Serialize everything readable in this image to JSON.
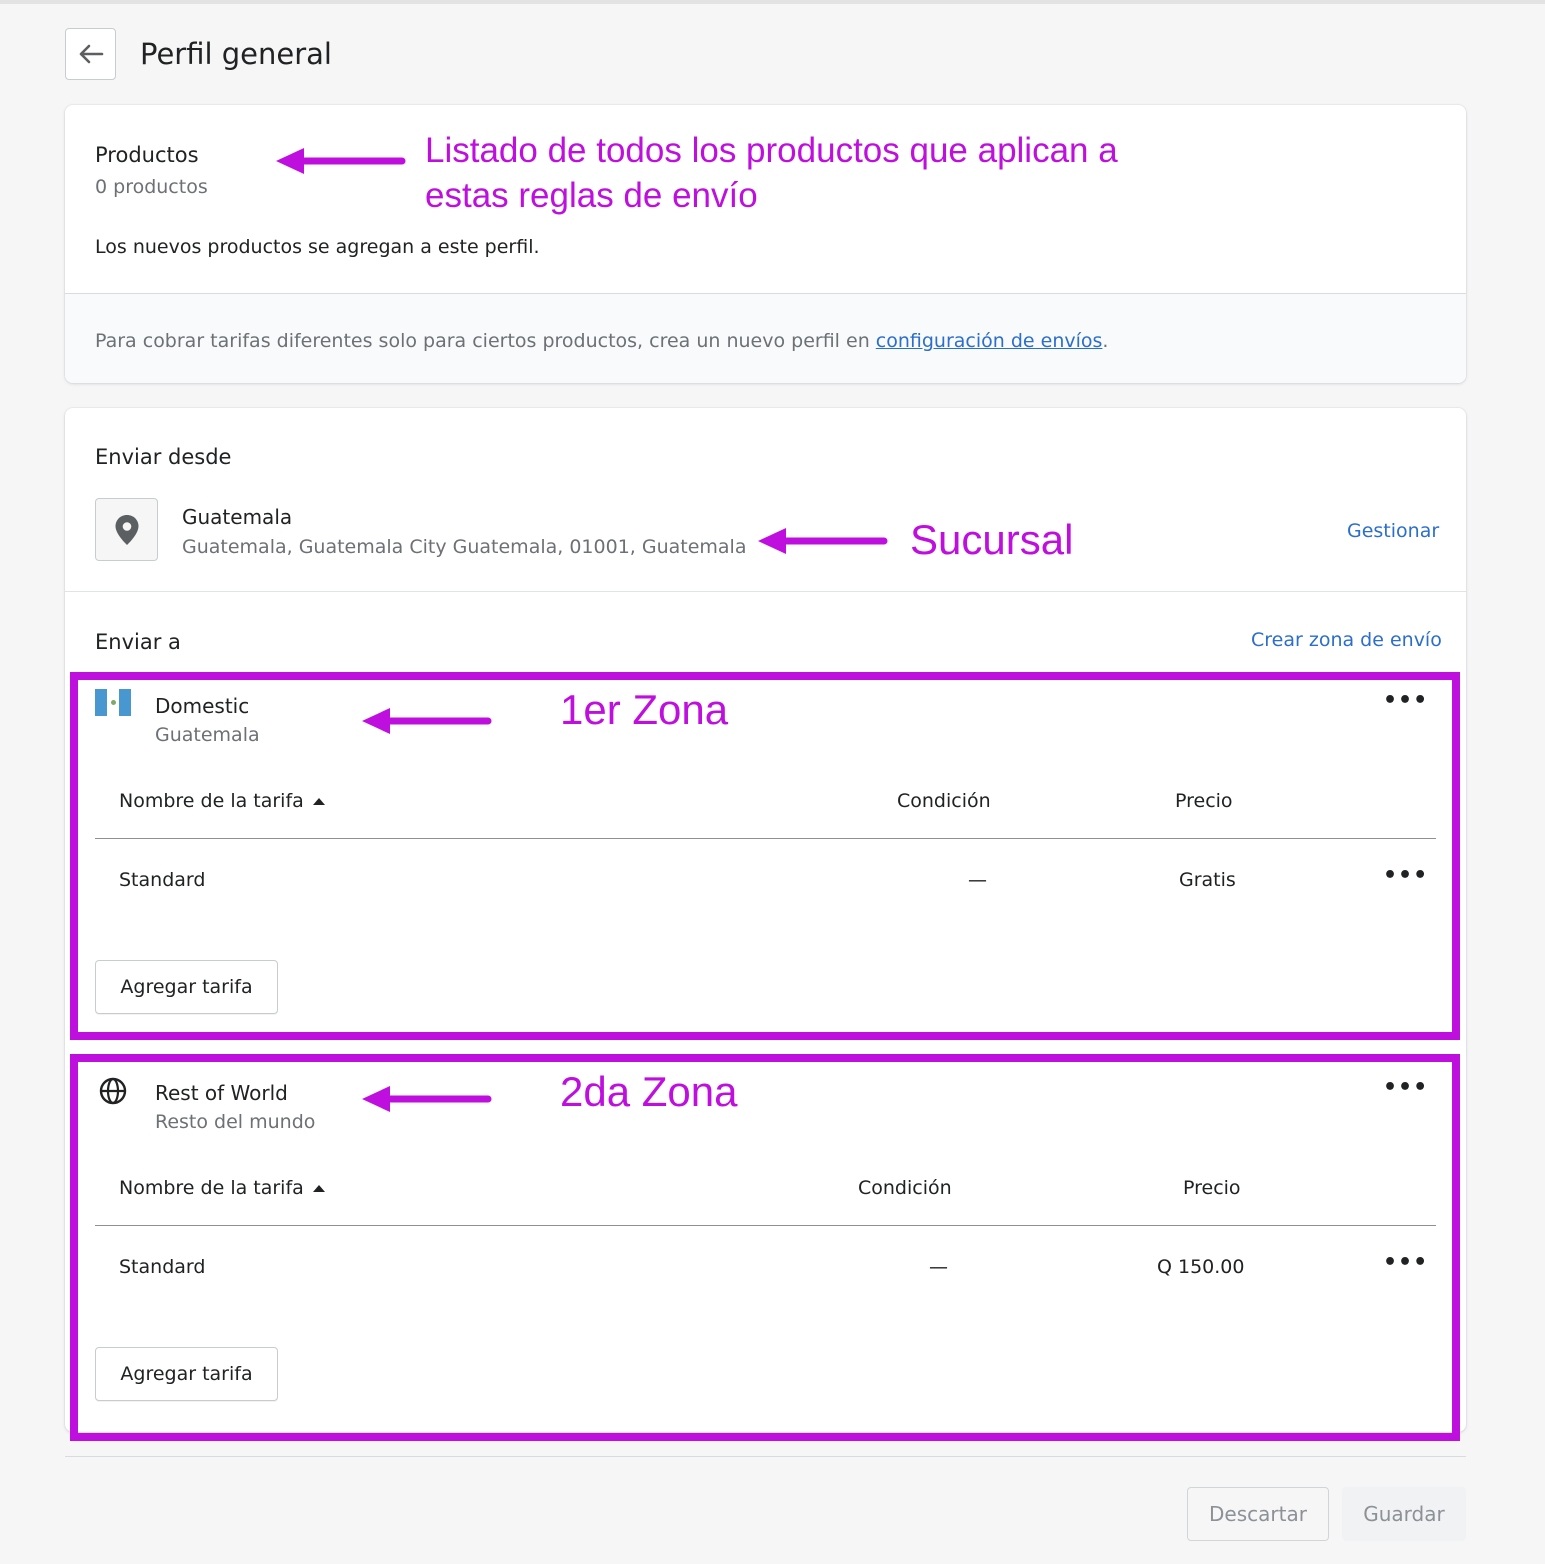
{
  "header": {
    "title": "Perfil general"
  },
  "products_card": {
    "title": "Productos",
    "count": "0 productos",
    "note": "Los nuevos productos se agregan a este perfil.",
    "footer_text": "Para cobrar tarifas diferentes solo para ciertos productos, crea un nuevo perfil en ",
    "footer_link": "configuración de envíos",
    "footer_end": "."
  },
  "ship_from": {
    "title": "Enviar desde",
    "location_name": "Guatemala",
    "location_address": "Guatemala, Guatemala City Guatemala, 01001, Guatemala",
    "manage_link": "Gestionar"
  },
  "ship_to": {
    "title": "Enviar a",
    "create_zone_link": "Crear zona de envío",
    "zones": [
      {
        "name": "Domestic",
        "region": "Guatemala",
        "col_name": "Nombre de la tarifa",
        "col_condition": "Condición",
        "col_price": "Precio",
        "rate_name": "Standard",
        "rate_condition": "—",
        "rate_price": "Gratis",
        "add_button": "Agregar tarifa"
      },
      {
        "name": "Rest of World",
        "region": "Resto del mundo",
        "col_name": "Nombre de la tarifa",
        "col_condition": "Condición",
        "col_price": "Precio",
        "rate_name": "Standard",
        "rate_condition": "—",
        "rate_price": "Q 150.00",
        "add_button": "Agregar tarifa"
      }
    ]
  },
  "annotations": {
    "products_line1": "Listado de todos los productos que aplican a",
    "products_line2": "estas reglas de envío",
    "branch": "Sucursal",
    "zone1": "1er Zona",
    "zone2": "2da Zona"
  },
  "footer": {
    "discard": "Descartar",
    "save": "Guardar"
  },
  "colors": {
    "annotation": "#bf0fde",
    "link": "#2c6ecb"
  }
}
